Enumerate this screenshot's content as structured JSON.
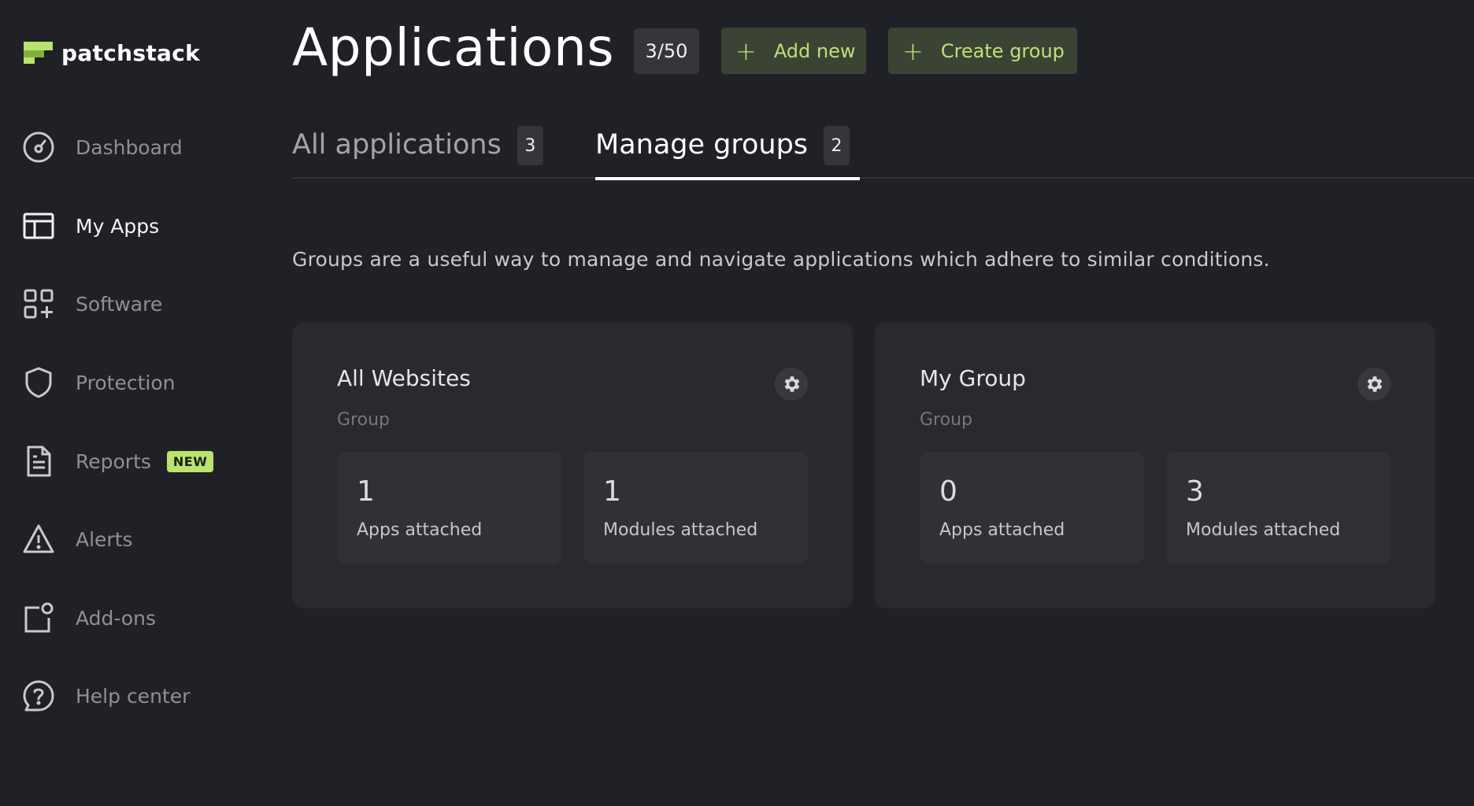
{
  "brand": {
    "name": "patchstack",
    "accent": "#b9e36c",
    "accent_dark": "#3b4434"
  },
  "sidebar": {
    "items": [
      {
        "label": "Dashboard",
        "icon": "gauge-icon"
      },
      {
        "label": "My Apps",
        "icon": "layout-icon",
        "active": true
      },
      {
        "label": "Software",
        "icon": "grid-plus-icon"
      },
      {
        "label": "Protection",
        "icon": "shield-icon"
      },
      {
        "label": "Reports",
        "icon": "document-icon",
        "badge": "NEW"
      },
      {
        "label": "Alerts",
        "icon": "warning-icon"
      },
      {
        "label": "Add-ons",
        "icon": "addon-icon"
      },
      {
        "label": "Help center",
        "icon": "help-icon"
      }
    ]
  },
  "header": {
    "title": "Applications",
    "count": "3/50",
    "add_new": "Add new",
    "create_group": "Create group"
  },
  "tabs": [
    {
      "label": "All applications",
      "count": "3"
    },
    {
      "label": "Manage groups",
      "count": "2",
      "active": true
    }
  ],
  "description": "Groups are a useful way to manage and navigate applications which adhere to similar conditions.",
  "groups": [
    {
      "name": "All Websites",
      "type": "Group",
      "apps": "1",
      "apps_label": "Apps attached",
      "modules": "1",
      "modules_label": "Modules attached"
    },
    {
      "name": "My Group",
      "type": "Group",
      "apps": "0",
      "apps_label": "Apps attached",
      "modules": "3",
      "modules_label": "Modules attached"
    }
  ]
}
